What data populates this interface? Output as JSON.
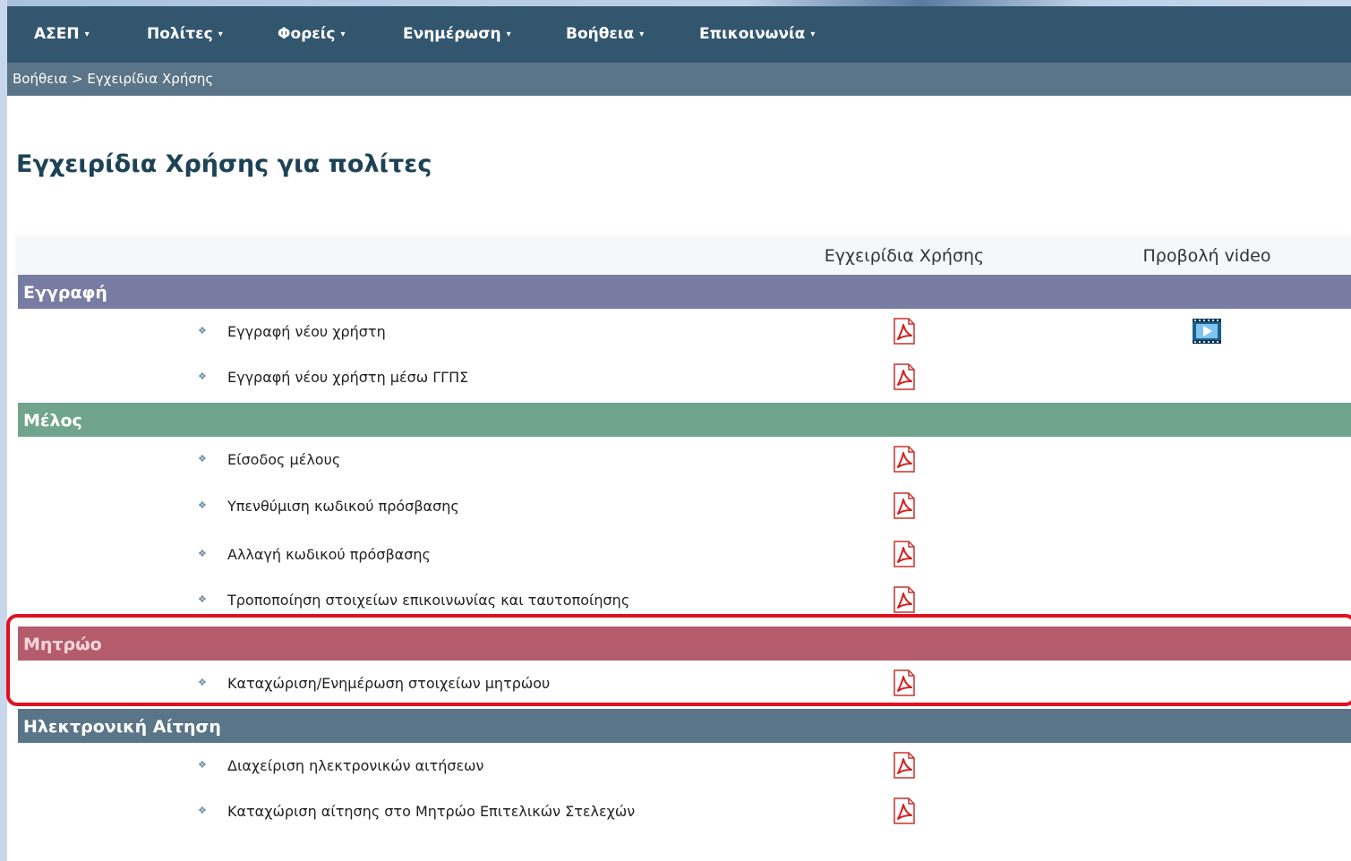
{
  "nav": {
    "items": [
      {
        "label": "ΑΣΕΠ"
      },
      {
        "label": "Πολίτες"
      },
      {
        "label": "Φορείς"
      },
      {
        "label": "Ενημέρωση"
      },
      {
        "label": "Βοήθεια"
      },
      {
        "label": "Επικοινωνία"
      }
    ],
    "caret": "▾"
  },
  "breadcrumb": {
    "text": "Βοήθεια > Εγχειρίδια Χρήσης"
  },
  "page": {
    "title": "Εγχειρίδια Χρήσης για πολίτες"
  },
  "table": {
    "headers": {
      "manuals": "Εγχειρίδια Χρήσης",
      "video": "Προβολή video"
    },
    "bullet": "❖",
    "sections": [
      {
        "title": "Εγγραφή",
        "color": "#787ba2",
        "rows": [
          {
            "label": "Εγγραφή νέου χρήστη",
            "pdf": true,
            "video": true
          },
          {
            "label": "Εγγραφή νέου χρήστη μέσω ΓΓΠΣ",
            "pdf": true,
            "video": false
          }
        ]
      },
      {
        "title": "Μέλος",
        "color": "#71a48d",
        "rows": [
          {
            "label": "Είσοδος μέλους",
            "pdf": true,
            "video": false
          },
          {
            "label": "Υπενθύμιση κωδικού πρόσβασης",
            "pdf": true,
            "video": false
          },
          {
            "label": "Αλλαγή κωδικού πρόσβασης",
            "pdf": true,
            "video": false
          },
          {
            "label": "Τροποποίηση στοιχείων επικοινωνίας και ταυτοποίησης",
            "pdf": true,
            "video": false
          }
        ]
      },
      {
        "title": "Μητρώο",
        "color": "#b45c6b",
        "highlighted": true,
        "rows": [
          {
            "label": "Καταχώριση/Ενημέρωση στοιχείων μητρώου",
            "pdf": true,
            "video": false
          }
        ]
      },
      {
        "title": "Ηλεκτρονική Αίτηση",
        "color": "#5a7587",
        "rows": [
          {
            "label": "Διαχείριση ηλεκτρονικών αιτήσεων",
            "pdf": true,
            "video": false
          },
          {
            "label": "Καταχώριση αίτησης στο Μητρώο Επιτελικών Στελεχών",
            "pdf": true,
            "video": false
          }
        ]
      }
    ]
  },
  "colors": {
    "navbar": "#33566f",
    "breadcrumb": "#5a7587",
    "title": "#1d4256",
    "highlight_border": "#e0111f",
    "highlight_fill": "#f9c6cc"
  }
}
